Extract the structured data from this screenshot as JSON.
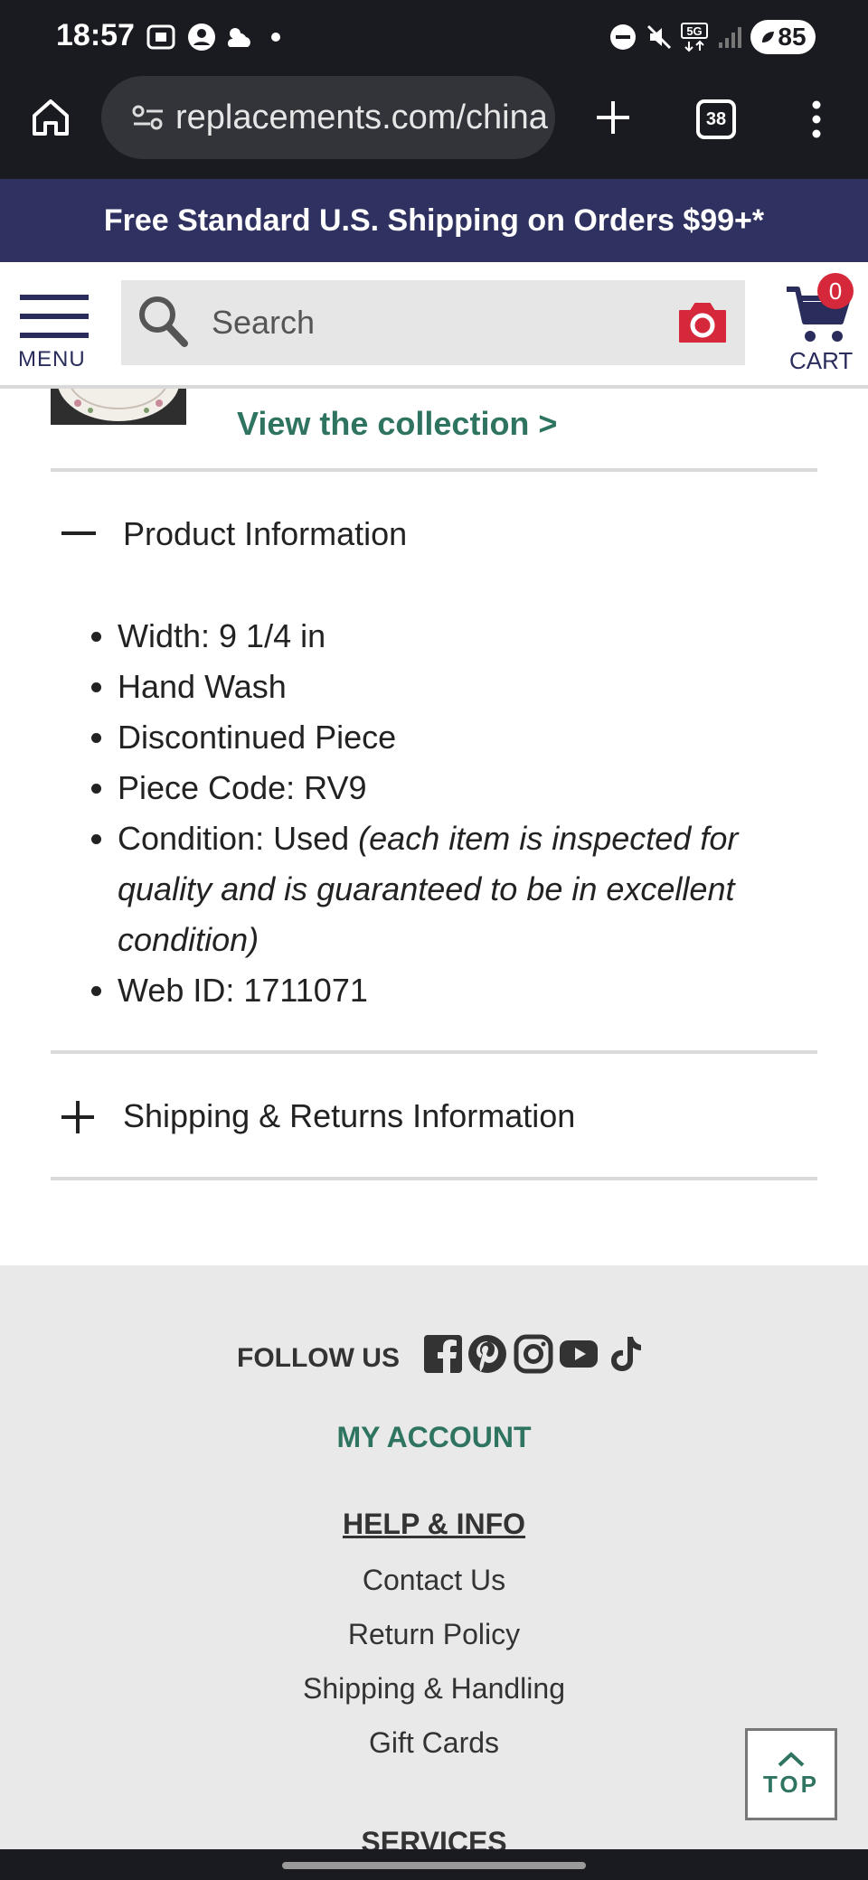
{
  "status_bar": {
    "time": "18:57",
    "battery": "85",
    "network": "5G"
  },
  "browser": {
    "url": "replacements.com/china",
    "tab_count": "38"
  },
  "promo_banner": {
    "text": "Free Standard U.S. Shipping on Orders $99+*"
  },
  "header": {
    "menu_label": "MENU",
    "search_placeholder": "Search",
    "cart_label": "CART",
    "cart_count": "0"
  },
  "collection": {
    "link_label": "View the collection >"
  },
  "product_information": {
    "title": "Product Information",
    "expanded": true,
    "specs": [
      {
        "text": "Width: 9 1/4 in",
        "note": ""
      },
      {
        "text": "Hand Wash",
        "note": ""
      },
      {
        "text": "Discontinued Piece",
        "note": ""
      },
      {
        "text": "Piece Code: RV9",
        "note": ""
      },
      {
        "text": "Condition: Used ",
        "note": "(each item is inspected for quality and is guaranteed to be in excellent condition)"
      },
      {
        "text": "Web ID: 1711071",
        "note": ""
      }
    ]
  },
  "shipping_returns": {
    "title": "Shipping & Returns Information",
    "expanded": false
  },
  "footer": {
    "follow_us": "FOLLOW US",
    "social_icons": [
      "facebook-icon",
      "pinterest-icon",
      "instagram-icon",
      "youtube-icon",
      "tiktok-icon"
    ],
    "my_account": "MY ACCOUNT",
    "help_heading": "HELP & INFO",
    "help_links": [
      "Contact Us",
      "Return Policy",
      "Shipping & Handling",
      "Gift Cards"
    ],
    "services_heading": "SERVICES"
  },
  "back_to_top": {
    "label": "TOP"
  },
  "colors": {
    "brand_navy": "#2f3160",
    "accent_green": "#2e7461",
    "badge_red": "#d6283b",
    "footer_bg": "#e9e9e9"
  }
}
